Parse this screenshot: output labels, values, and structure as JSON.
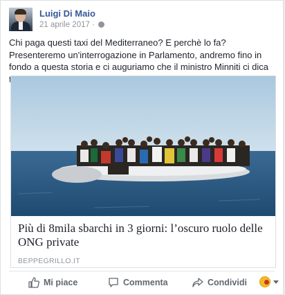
{
  "post": {
    "author": "Luigi Di Maio",
    "date": "21 aprile 2017 ·",
    "text": "Chi paga questi taxi del Mediterraneo? E perchè lo fa? Presenteremo un'interrogazione in Parlamento, andremo fino in fondo a questa storia e ci auguriamo che il ministro Minniti ci dica tutto quello che sa."
  },
  "link": {
    "headline": "Più di 8mila sbarchi in 3 giorni: l’oscuro ruolo delle ONG private",
    "domain": "BEPPEGRILLO.IT"
  },
  "actions": {
    "like": "Mi piace",
    "comment": "Commenta",
    "share": "Condividi"
  },
  "icons": {
    "like": "thumbs-up-icon",
    "comment": "speech-bubble-icon",
    "share": "share-arrow-icon",
    "privacy": "globe-icon",
    "reaction": "reaction-emoji-icon",
    "reaction_menu": "caret-down-icon"
  },
  "colors": {
    "author_link": "#365899",
    "meta_text": "#90949c",
    "action_text": "#606770"
  }
}
